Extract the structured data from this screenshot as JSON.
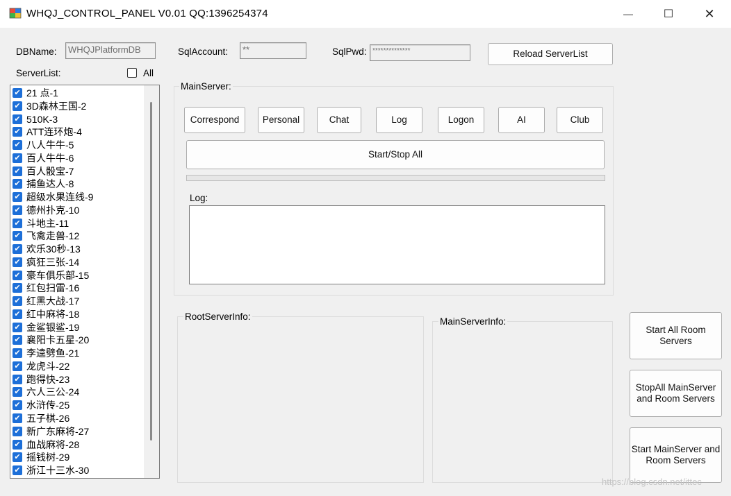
{
  "window": {
    "title": "WHQJ_CONTROL_PANEL V0.01  QQ:1396254374",
    "minimize": "—",
    "maximize": "☐",
    "close": "✕"
  },
  "db": {
    "dbname_label": "DBName:",
    "dbname_value": "WHQJPlatformDB",
    "sqlaccount_label": "SqlAccount:",
    "sqlaccount_value": "**",
    "sqlpwd_label": "SqlPwd:",
    "sqlpwd_value": "**************",
    "reload_button": "Reload ServerList"
  },
  "serverlist": {
    "label": "ServerList:",
    "all_label": "All",
    "all_checked": false,
    "items": [
      {
        "label": "21 点-1",
        "checked": true
      },
      {
        "label": "3D森林王国-2",
        "checked": true
      },
      {
        "label": "510K-3",
        "checked": true
      },
      {
        "label": "ATT连环炮-4",
        "checked": true
      },
      {
        "label": "八人牛牛-5",
        "checked": true
      },
      {
        "label": "百人牛牛-6",
        "checked": true
      },
      {
        "label": "百人骰宝-7",
        "checked": true
      },
      {
        "label": "捕鱼达人-8",
        "checked": true
      },
      {
        "label": "超级水果连线-9",
        "checked": true
      },
      {
        "label": "德州扑克-10",
        "checked": true
      },
      {
        "label": "斗地主-11",
        "checked": true
      },
      {
        "label": "飞禽走兽-12",
        "checked": true
      },
      {
        "label": "欢乐30秒-13",
        "checked": true
      },
      {
        "label": "疯狂三张-14",
        "checked": true
      },
      {
        "label": "豪车俱乐部-15",
        "checked": true
      },
      {
        "label": "红包扫雷-16",
        "checked": true
      },
      {
        "label": "红黑大战-17",
        "checked": true
      },
      {
        "label": "红中麻将-18",
        "checked": true
      },
      {
        "label": "金鲨银鲨-19",
        "checked": true
      },
      {
        "label": "襄阳卡五星-20",
        "checked": true
      },
      {
        "label": "李逵劈鱼-21",
        "checked": true
      },
      {
        "label": "龙虎斗-22",
        "checked": true
      },
      {
        "label": "跑得快-23",
        "checked": true
      },
      {
        "label": "六人三公-24",
        "checked": true
      },
      {
        "label": "水浒传-25",
        "checked": true
      },
      {
        "label": "五子棋-26",
        "checked": true
      },
      {
        "label": "新广东麻将-27",
        "checked": true
      },
      {
        "label": "血战麻将-28",
        "checked": true
      },
      {
        "label": "摇钱树-29",
        "checked": true
      },
      {
        "label": "浙江十三水-30",
        "checked": true
      }
    ]
  },
  "mainserver": {
    "group_label": "MainServer:",
    "buttons": [
      "Correspond",
      "Personal",
      "Chat",
      "Log",
      "Logon",
      "AI",
      "Club"
    ],
    "startstop_all": "Start/Stop  All",
    "log_label": "Log:"
  },
  "rootserverinfo": {
    "label": "RootServerInfo:"
  },
  "mainserverinfo": {
    "label": "MainServerInfo:"
  },
  "actions": {
    "start_all_room": "Start All Room Servers",
    "stop_all_main_room": "StopAll MainServer and Room Servers",
    "start_main_room": "Start MainServer and Room Servers"
  },
  "watermark": "https://blog.csdn.net/ittec"
}
